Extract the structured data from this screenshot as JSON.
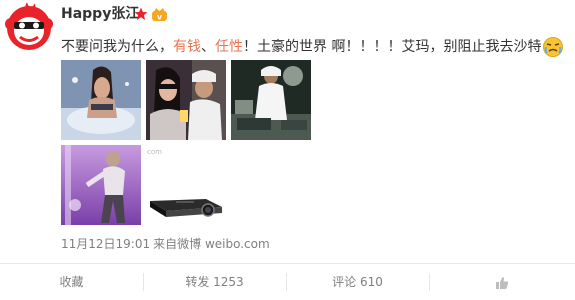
{
  "user": {
    "name": "Happy张江",
    "avatar_icon": "red-monkey-face-avatar",
    "badges": [
      "red-star-icon",
      "vip-crown-icon"
    ]
  },
  "post": {
    "text_part1": "不要问我为什么，",
    "hl1": "有钱",
    "sep": "、",
    "hl2": "任性",
    "text_part2": "！土豪的世界 啊！！！！艾玛，别阻止我去沙特",
    "emoji_icon": "crying-face-emoji",
    "images": [
      "photo-woman-in-pool",
      "photo-party-selfie",
      "photo-men-in-white-robes",
      "photo-dancer-purple",
      "photo-projector-device"
    ],
    "watermark": "com",
    "time": "11月12日19:01",
    "source": "来自微博 weibo.com"
  },
  "actions": {
    "favorite": "收藏",
    "repost": "转发 1253",
    "comment": "评论 610",
    "like_icon": "thumbs-up-icon"
  },
  "colors": {
    "highlight": "#eb7350",
    "meta": "#808080"
  }
}
